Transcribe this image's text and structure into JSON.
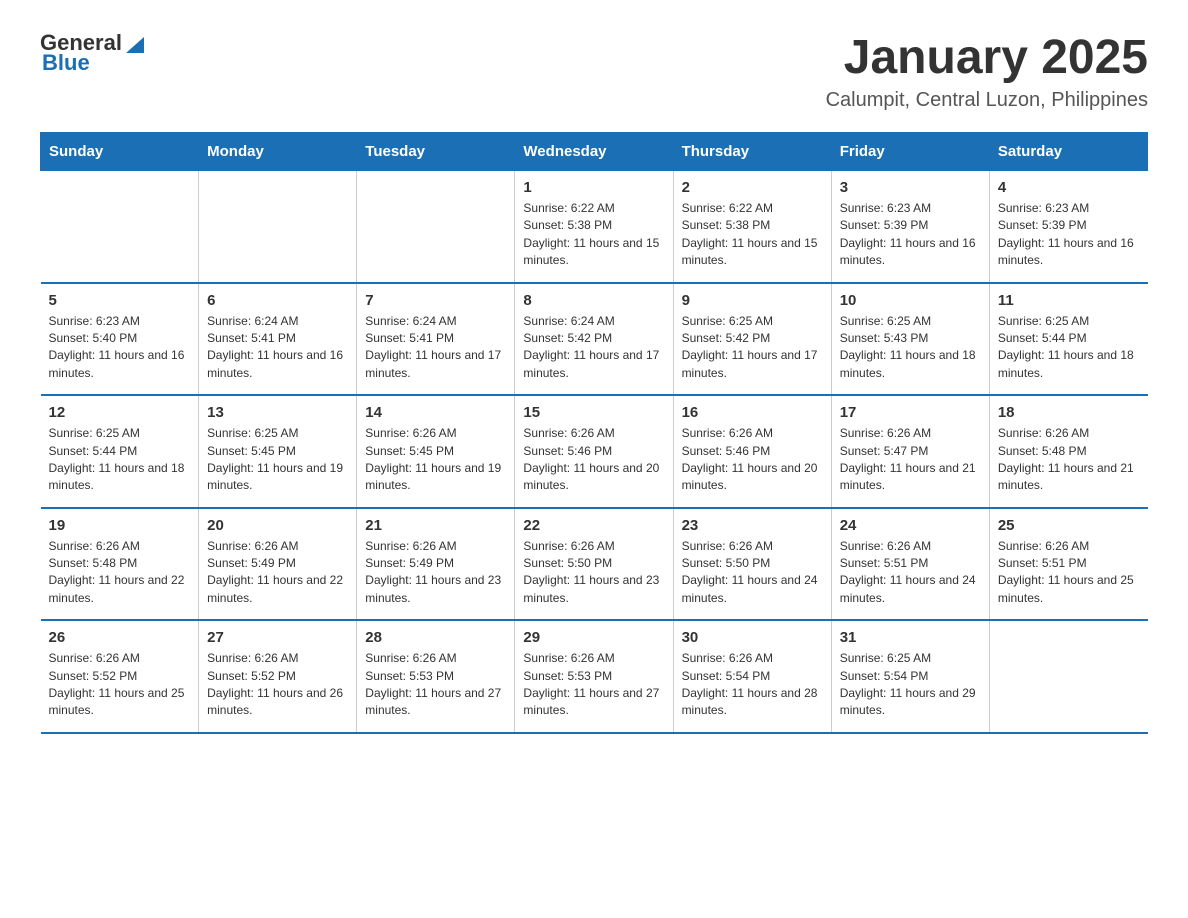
{
  "header": {
    "logo_general": "General",
    "logo_blue": "Blue",
    "title": "January 2025",
    "subtitle": "Calumpit, Central Luzon, Philippines"
  },
  "days_of_week": [
    "Sunday",
    "Monday",
    "Tuesday",
    "Wednesday",
    "Thursday",
    "Friday",
    "Saturday"
  ],
  "weeks": [
    [
      {
        "day": "",
        "sunrise": "",
        "sunset": "",
        "daylight": ""
      },
      {
        "day": "",
        "sunrise": "",
        "sunset": "",
        "daylight": ""
      },
      {
        "day": "",
        "sunrise": "",
        "sunset": "",
        "daylight": ""
      },
      {
        "day": "1",
        "sunrise": "Sunrise: 6:22 AM",
        "sunset": "Sunset: 5:38 PM",
        "daylight": "Daylight: 11 hours and 15 minutes."
      },
      {
        "day": "2",
        "sunrise": "Sunrise: 6:22 AM",
        "sunset": "Sunset: 5:38 PM",
        "daylight": "Daylight: 11 hours and 15 minutes."
      },
      {
        "day": "3",
        "sunrise": "Sunrise: 6:23 AM",
        "sunset": "Sunset: 5:39 PM",
        "daylight": "Daylight: 11 hours and 16 minutes."
      },
      {
        "day": "4",
        "sunrise": "Sunrise: 6:23 AM",
        "sunset": "Sunset: 5:39 PM",
        "daylight": "Daylight: 11 hours and 16 minutes."
      }
    ],
    [
      {
        "day": "5",
        "sunrise": "Sunrise: 6:23 AM",
        "sunset": "Sunset: 5:40 PM",
        "daylight": "Daylight: 11 hours and 16 minutes."
      },
      {
        "day": "6",
        "sunrise": "Sunrise: 6:24 AM",
        "sunset": "Sunset: 5:41 PM",
        "daylight": "Daylight: 11 hours and 16 minutes."
      },
      {
        "day": "7",
        "sunrise": "Sunrise: 6:24 AM",
        "sunset": "Sunset: 5:41 PM",
        "daylight": "Daylight: 11 hours and 17 minutes."
      },
      {
        "day": "8",
        "sunrise": "Sunrise: 6:24 AM",
        "sunset": "Sunset: 5:42 PM",
        "daylight": "Daylight: 11 hours and 17 minutes."
      },
      {
        "day": "9",
        "sunrise": "Sunrise: 6:25 AM",
        "sunset": "Sunset: 5:42 PM",
        "daylight": "Daylight: 11 hours and 17 minutes."
      },
      {
        "day": "10",
        "sunrise": "Sunrise: 6:25 AM",
        "sunset": "Sunset: 5:43 PM",
        "daylight": "Daylight: 11 hours and 18 minutes."
      },
      {
        "day": "11",
        "sunrise": "Sunrise: 6:25 AM",
        "sunset": "Sunset: 5:44 PM",
        "daylight": "Daylight: 11 hours and 18 minutes."
      }
    ],
    [
      {
        "day": "12",
        "sunrise": "Sunrise: 6:25 AM",
        "sunset": "Sunset: 5:44 PM",
        "daylight": "Daylight: 11 hours and 18 minutes."
      },
      {
        "day": "13",
        "sunrise": "Sunrise: 6:25 AM",
        "sunset": "Sunset: 5:45 PM",
        "daylight": "Daylight: 11 hours and 19 minutes."
      },
      {
        "day": "14",
        "sunrise": "Sunrise: 6:26 AM",
        "sunset": "Sunset: 5:45 PM",
        "daylight": "Daylight: 11 hours and 19 minutes."
      },
      {
        "day": "15",
        "sunrise": "Sunrise: 6:26 AM",
        "sunset": "Sunset: 5:46 PM",
        "daylight": "Daylight: 11 hours and 20 minutes."
      },
      {
        "day": "16",
        "sunrise": "Sunrise: 6:26 AM",
        "sunset": "Sunset: 5:46 PM",
        "daylight": "Daylight: 11 hours and 20 minutes."
      },
      {
        "day": "17",
        "sunrise": "Sunrise: 6:26 AM",
        "sunset": "Sunset: 5:47 PM",
        "daylight": "Daylight: 11 hours and 21 minutes."
      },
      {
        "day": "18",
        "sunrise": "Sunrise: 6:26 AM",
        "sunset": "Sunset: 5:48 PM",
        "daylight": "Daylight: 11 hours and 21 minutes."
      }
    ],
    [
      {
        "day": "19",
        "sunrise": "Sunrise: 6:26 AM",
        "sunset": "Sunset: 5:48 PM",
        "daylight": "Daylight: 11 hours and 22 minutes."
      },
      {
        "day": "20",
        "sunrise": "Sunrise: 6:26 AM",
        "sunset": "Sunset: 5:49 PM",
        "daylight": "Daylight: 11 hours and 22 minutes."
      },
      {
        "day": "21",
        "sunrise": "Sunrise: 6:26 AM",
        "sunset": "Sunset: 5:49 PM",
        "daylight": "Daylight: 11 hours and 23 minutes."
      },
      {
        "day": "22",
        "sunrise": "Sunrise: 6:26 AM",
        "sunset": "Sunset: 5:50 PM",
        "daylight": "Daylight: 11 hours and 23 minutes."
      },
      {
        "day": "23",
        "sunrise": "Sunrise: 6:26 AM",
        "sunset": "Sunset: 5:50 PM",
        "daylight": "Daylight: 11 hours and 24 minutes."
      },
      {
        "day": "24",
        "sunrise": "Sunrise: 6:26 AM",
        "sunset": "Sunset: 5:51 PM",
        "daylight": "Daylight: 11 hours and 24 minutes."
      },
      {
        "day": "25",
        "sunrise": "Sunrise: 6:26 AM",
        "sunset": "Sunset: 5:51 PM",
        "daylight": "Daylight: 11 hours and 25 minutes."
      }
    ],
    [
      {
        "day": "26",
        "sunrise": "Sunrise: 6:26 AM",
        "sunset": "Sunset: 5:52 PM",
        "daylight": "Daylight: 11 hours and 25 minutes."
      },
      {
        "day": "27",
        "sunrise": "Sunrise: 6:26 AM",
        "sunset": "Sunset: 5:52 PM",
        "daylight": "Daylight: 11 hours and 26 minutes."
      },
      {
        "day": "28",
        "sunrise": "Sunrise: 6:26 AM",
        "sunset": "Sunset: 5:53 PM",
        "daylight": "Daylight: 11 hours and 27 minutes."
      },
      {
        "day": "29",
        "sunrise": "Sunrise: 6:26 AM",
        "sunset": "Sunset: 5:53 PM",
        "daylight": "Daylight: 11 hours and 27 minutes."
      },
      {
        "day": "30",
        "sunrise": "Sunrise: 6:26 AM",
        "sunset": "Sunset: 5:54 PM",
        "daylight": "Daylight: 11 hours and 28 minutes."
      },
      {
        "day": "31",
        "sunrise": "Sunrise: 6:25 AM",
        "sunset": "Sunset: 5:54 PM",
        "daylight": "Daylight: 11 hours and 29 minutes."
      },
      {
        "day": "",
        "sunrise": "",
        "sunset": "",
        "daylight": ""
      }
    ]
  ]
}
